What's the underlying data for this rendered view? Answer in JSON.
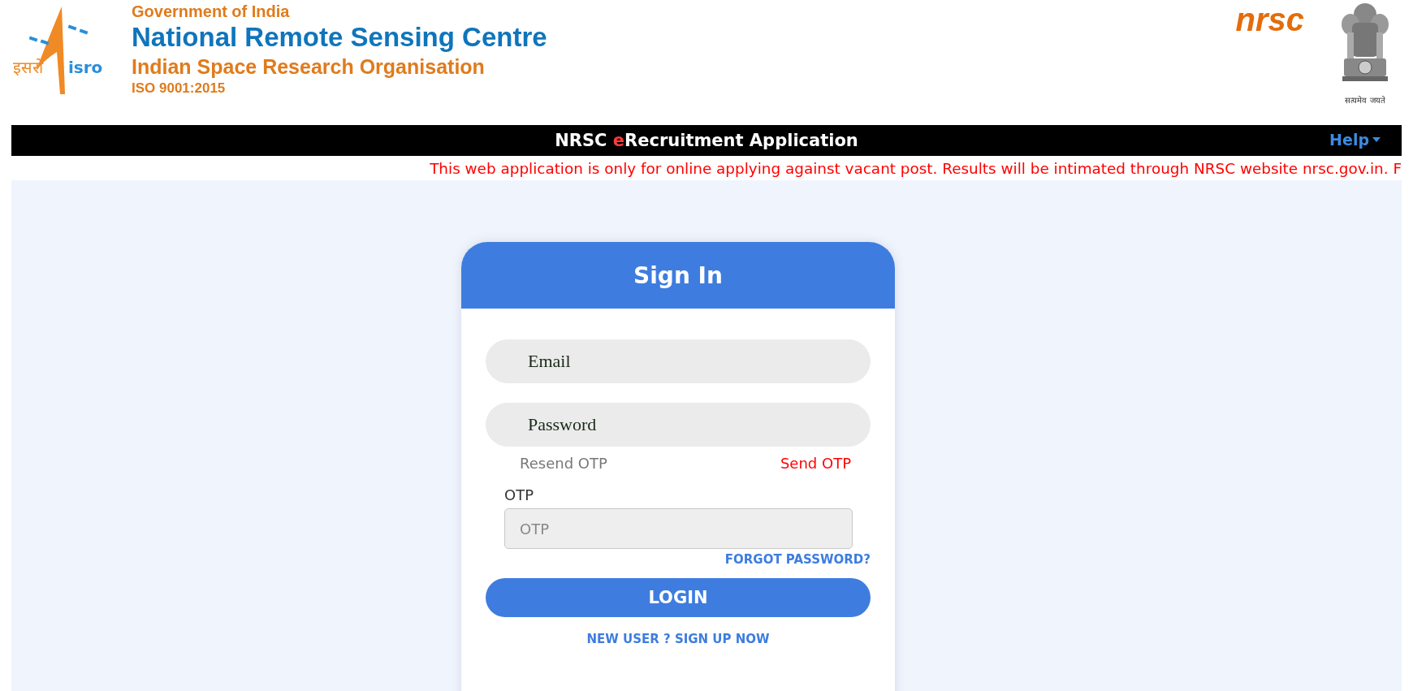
{
  "header": {
    "isro_logo": {
      "hindi": "इसरो",
      "latin": "isro"
    },
    "government": "Government of India",
    "centre": "National Remote Sensing Centre",
    "organisation": "Indian Space Research Organisation",
    "certification": "ISO 9001:2015",
    "nrsc_logo": "nrsc",
    "emblem_motto": "सत्यमेव जयते"
  },
  "navbar": {
    "title_start": "NRSC ",
    "title_accent": "e",
    "title_end": "Recruitment Application",
    "help": "Help"
  },
  "notice": "This web application is only for online applying against vacant post. Results will be intimated through NRSC website nrsc.gov.in. F",
  "sign_in": {
    "title": "Sign In",
    "email": {
      "placeholder": "Email"
    },
    "password": {
      "placeholder": "Password"
    },
    "resend_otp": {
      "label": "Resend OTP",
      "disabled": true
    },
    "send_otp": "Send OTP",
    "otp_label": "OTP",
    "otp": {
      "placeholder": "OTP"
    },
    "forgot_password": "FORGOT PASSWORD?",
    "login": "LOGIN",
    "sign_up": "NEW USER ? SIGN UP NOW"
  }
}
